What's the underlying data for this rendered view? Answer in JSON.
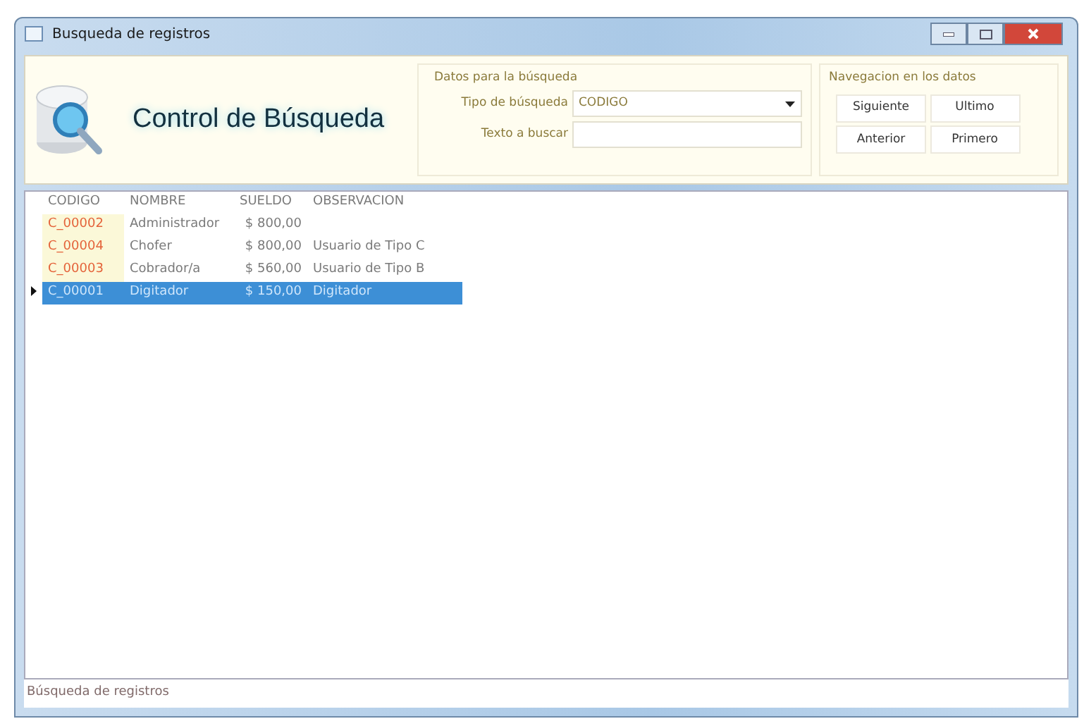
{
  "window": {
    "title": "Busqueda de registros"
  },
  "header": {
    "title": "Control de Búsqueda"
  },
  "search": {
    "group_title": "Datos para la búsqueda",
    "type_label": "Tipo de búsqueda",
    "type_value": "CODIGO",
    "text_label": "Texto a buscar"
  },
  "navigation": {
    "group_title": "Navegacion en los datos",
    "buttons": [
      "Siguiente",
      "Ultimo",
      "Anterior",
      "Primero"
    ]
  },
  "table": {
    "columns": [
      "CODIGO",
      "NOMBRE",
      "SUELDO",
      "OBSERVACION"
    ],
    "rows": [
      {
        "cells": [
          "C_00002",
          "Administrador",
          "$ 800,00",
          ""
        ],
        "selected": false
      },
      {
        "cells": [
          "C_00004",
          "Chofer",
          "$ 800,00",
          "Usuario de Tipo C"
        ],
        "selected": false
      },
      {
        "cells": [
          "C_00003",
          "Cobrador/a",
          "$ 560,00",
          "Usuario de Tipo B"
        ],
        "selected": false
      },
      {
        "cells": [
          "C_00001",
          "Digitador",
          "$ 150,00",
          "Digitador"
        ],
        "selected": true
      }
    ]
  },
  "status_bar": "Búsqueda de registros"
}
